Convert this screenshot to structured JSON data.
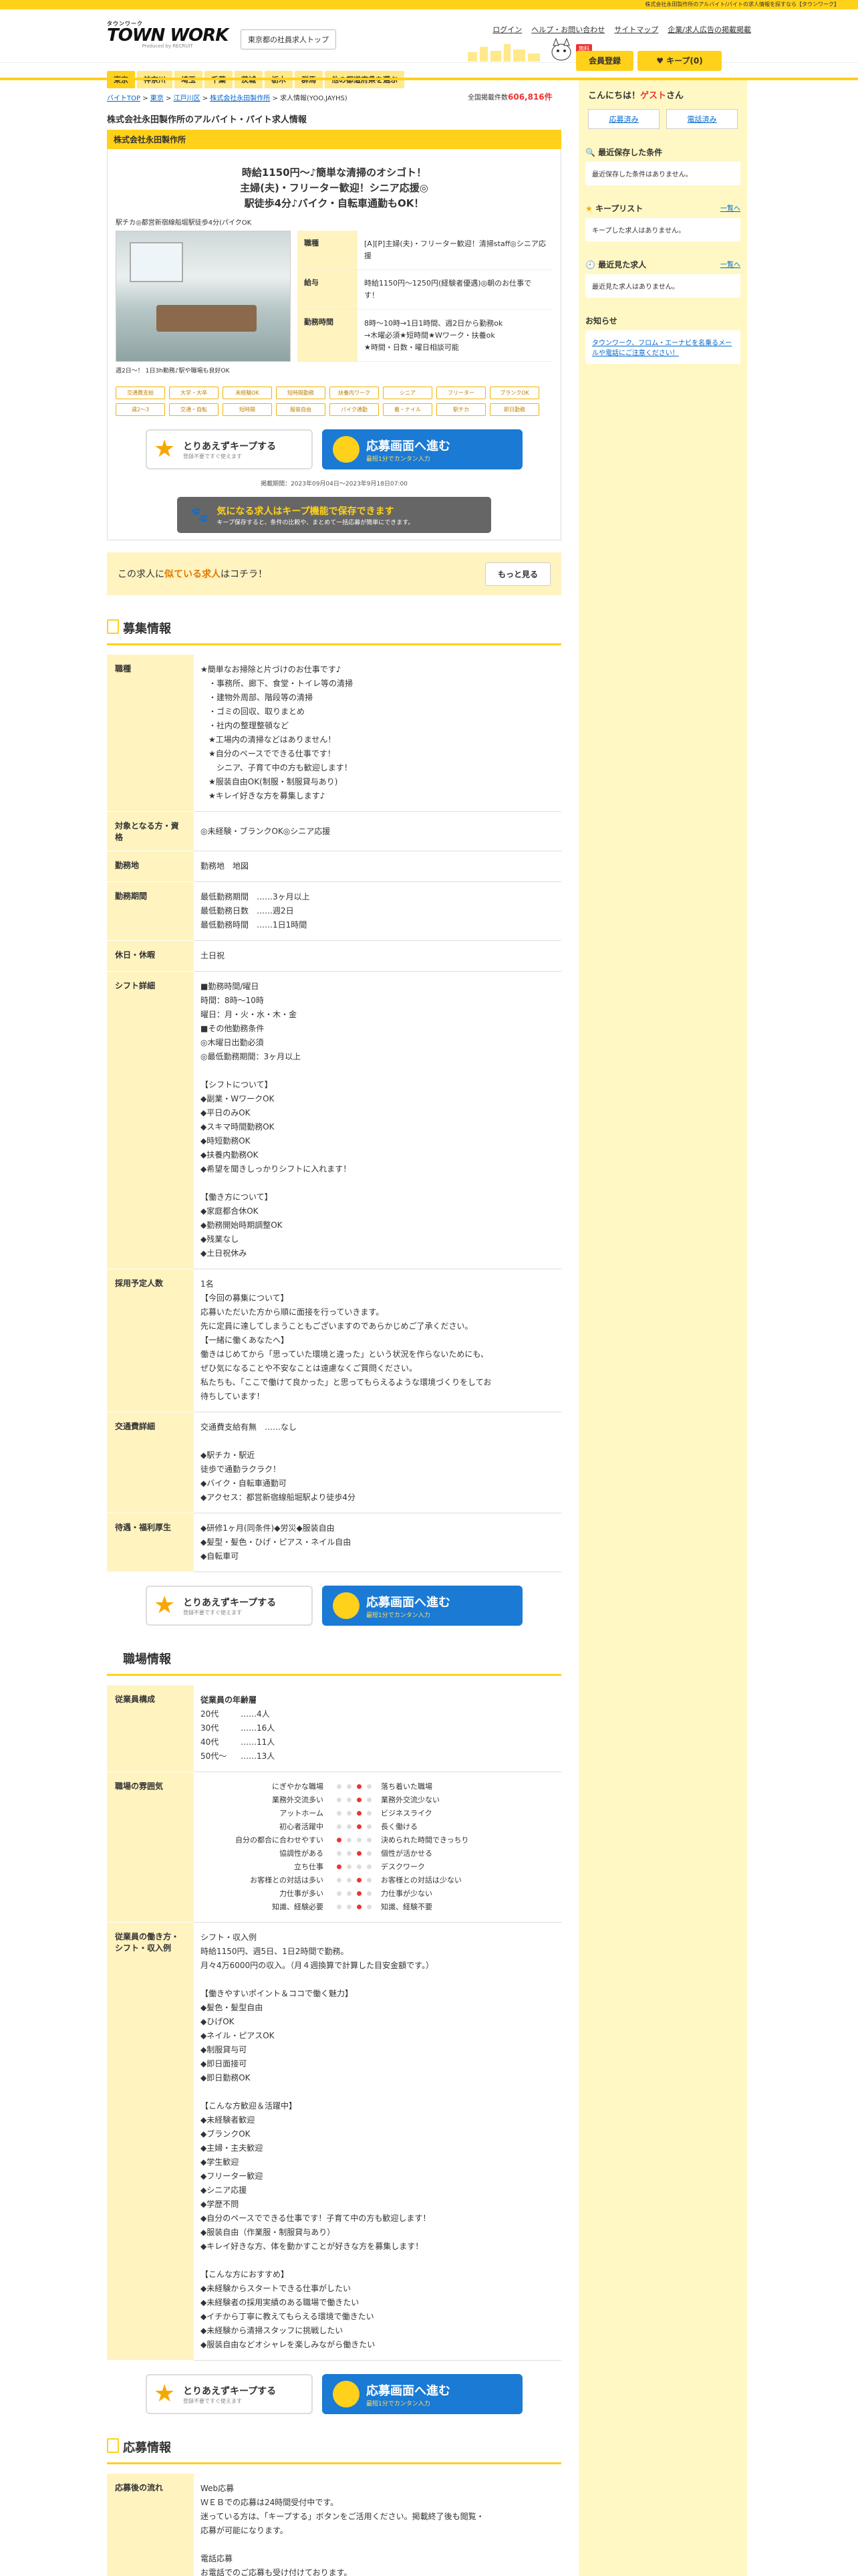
{
  "topbar": {
    "text": "株式会社永田製作所のアルバイト/パイトの求人情報を探すなら【タウンワーク】"
  },
  "header": {
    "logo_small": "タウンワーク",
    "logo_main": "TOWN WORK",
    "logo_sub": "Produced by RECRUIT",
    "store_button": "東京都の社員求人トップ",
    "utility": [
      "ログイン",
      "ヘルプ・お問い合わせ",
      "サイトマップ",
      "企業/求人広告の掲載掲載"
    ],
    "member_badge": "無料",
    "member_button": "会員登録",
    "keep_button": "キープ(0)"
  },
  "nav": [
    "東京",
    "神奈川",
    "埼玉",
    "千葉",
    "茨城",
    "栃木",
    "群馬",
    "他の都道府県を選ぶ"
  ],
  "breadcrumb": [
    "バイトTOP",
    "東京",
    "江戸川区",
    "株式会社永田製作所",
    "求人情報(YOO.JAYHS)"
  ],
  "total": {
    "label": "全国掲載件数",
    "value": "606,816件"
  },
  "page_title": "株式会社永田製作所のアルバイト・パイト求人情報",
  "job": {
    "company": "株式会社永田製作所",
    "catch_lines": [
      "時給1150円〜♪簡単な清掃のオシゴト！",
      "主婦(夫)・フリーター歓迎！シニア応援◎",
      "駅徒歩4分♪バイク・自転車通勤もOK！"
    ],
    "station": "駅チカ◎都営新宿線船堀駅徒歩4分(パイクOK",
    "photo_caption": "週2日〜！ 1日3h勤務♪駅や職場も良好OK",
    "summary": [
      {
        "label": "職種",
        "value": "[A][P]主婦(夫)・フリーター歓迎！清掃staff◎シニア応援"
      },
      {
        "label": "給与",
        "value": "時給1150円〜1250円(経験者優遇)◎朝のお仕事です！"
      },
      {
        "label": "勤務時間",
        "value": "8時〜10時→1日1時間、週2日から勤務ok\n→木曜必須★短時間★Wワーク・扶養ok\n★時間・日数・曜日相談可能"
      }
    ],
    "tags": [
      "交通費支給",
      "大学・大卒",
      "未経験OK",
      "短時間勤務",
      "扶養内ワーク",
      "シニア",
      "フリーター",
      "ブランクOK",
      "週2〜3",
      "交通・自転",
      "短時間",
      "服装自由",
      "バイク通勤",
      "着・ナイル",
      "駅チカ",
      "即日勤務"
    ],
    "keep_cta": {
      "title": "とりあえずキープする",
      "sub": "登録不要ですぐ使えます"
    },
    "apply_cta": {
      "title": "応募画面へ進む",
      "sub": "最短1分でカンタン入力"
    },
    "period": "掲載期間：2023年09月04日〜2023年9月18日07:00",
    "keep_banner": {
      "title": "気になる求人はキープ機能で保存できます",
      "sub": "キープ保存すると、条件の比較や、まとめて一括応募が簡単にできます。"
    },
    "similar": {
      "prefix": "この求人に",
      "highlight": "似ている求人",
      "suffix": "はコチラ！",
      "button": "もっと見る"
    }
  },
  "recruit": {
    "heading": "募集情報",
    "rows": [
      {
        "label": "職種",
        "value": "★簡単なお掃除と片づけのお仕事です♪\n　・事務所、廊下、食堂・トイレ等の清掃\n　・建物外周部、階段等の清掃\n　・ゴミの回収、取りまとめ\n　・社内の整理整頓など\n　★工場内の清掃などはありません！\n　★自分のペースでできる仕事です！\n　　シニア、子育て中の方も歓迎します！\n　★服装自由OK(制服・制服貸与あり)\n　★キレイ好きな方を募集します♪"
      },
      {
        "label": "対象となる方・資格",
        "value": "◎未経験・ブランクOK◎シニア応援"
      },
      {
        "label": "勤務地",
        "value": "勤務地　地図"
      },
      {
        "label": "勤務期間",
        "value": "最低勤務期間　……3ヶ月以上\n最低勤務日数　……週2日\n最低勤務時間　……1日1時間"
      },
      {
        "label": "休日・休暇",
        "value": "土日祝"
      },
      {
        "label": "シフト詳細",
        "value": "■勤務時間/曜日\n時間：8時〜10時\n曜日：月・火・水・木・金\n■その他勤務条件\n◎木曜日出勤必須\n◎最低勤務期間：3ヶ月以上\n\n【シフトについて】\n◆副業・WワークOK\n◆平日のみOK\n◆スキマ時間勤務OK\n◆時短勤務OK\n◆扶養内勤務OK\n◆希望を聞きしっかりシフトに入れます！\n\n【働き方について】\n◆家庭都合休OK\n◆勤務開始時期調整OK\n◆残業なし\n◆土日祝休み"
      },
      {
        "label": "採用予定人数",
        "value": "1名\n【今回の募集について】\n応募いただいた方から順に面接を行っていきます。\n先に定員に達してしまうこともございますのであらかじめご了承ください。\n【一緒に働くあなたへ】\n働きはじめてから「思っていた環境と違った」という状況を作らないためにも、\nぜひ気になることや不安なことは遠慮なくご質問ください。\n私たちも、「ここで働けて良かった」と思ってもらえるような環境づくりをしてお\n待ちしています！"
      },
      {
        "label": "交通費詳細",
        "value": "交通費支給有無　……なし\n\n◆駅チカ・駅近\n徒歩で通勤ラクラク！\n◆バイク・自転車通勤可\n◆アクセス：都営新宿線船堀駅より徒歩4分"
      },
      {
        "label": "待遇・福利厚生",
        "value": "◆研修1ヶ月(同条件)◆労災◆服装自由\n◆髪型・髪色・ひげ・ピアス・ネイル自由\n◆自転車可"
      }
    ]
  },
  "workplace": {
    "heading": "職場情報",
    "age_title": "従業員の年齢層",
    "ages": [
      {
        "label": "20代",
        "value": "……4人"
      },
      {
        "label": "30代",
        "value": "……16人"
      },
      {
        "label": "40代",
        "value": "……11人"
      },
      {
        "label": "50代〜",
        "value": "……13人"
      }
    ],
    "age_row_label": "従業員構成",
    "atmo_label": "職場の雰囲気",
    "atmosphere": [
      {
        "left": "にぎやかな職場",
        "right": "落ち着いた職場",
        "pos": 2
      },
      {
        "left": "業務外交流多い",
        "right": "業務外交流少ない",
        "pos": 2
      },
      {
        "left": "アットホーム",
        "right": "ビジネスライク",
        "pos": 2
      },
      {
        "left": "初心者活躍中",
        "right": "長く働ける",
        "pos": 2
      },
      {
        "left": "自分の都合に合わせやすい",
        "right": "決められた時間できっちり",
        "pos": 0
      },
      {
        "left": "協調性がある",
        "right": "個性が活かせる",
        "pos": 2
      },
      {
        "left": "立ち仕事",
        "right": "デスクワーク",
        "pos": 0
      },
      {
        "left": "お客様との対話は多い",
        "right": "お客様との対話は少ない",
        "pos": 2
      },
      {
        "left": "力仕事が多い",
        "right": "力仕事が少ない",
        "pos": 2
      },
      {
        "left": "知識、経験必要",
        "right": "知識、経験不要",
        "pos": 2
      }
    ],
    "example_label": "従業員の働き方・シフト・収入例",
    "example_value": "シフト・収入例\n時給1150円、週5日、1日2時間で勤務。\n月々4万6000円の収入。（月４週換算で計算した目安金額です。）\n\n【働きやすいポイント＆ココで働く魅力】\n◆髪色・髪型自由\n◆ひげOK\n◆ネイル・ピアスOK\n◆制服貸与可\n◆即日面接可\n◆即日勤務OK\n\n【こんな方歓迎＆活躍中】\n◆未経験者歓迎\n◆ブランクOK\n◆主婦・主夫歓迎\n◆学生歓迎\n◆フリーター歓迎\n◆シニア応援\n◆学歴不問\n◆自分のペースでできる仕事です！子育て中の方も歓迎します！\n◆服装自由（作業服・制服貸与あり）\n◆キレイ好きな方、体を動かすことが好きな方を募集します！\n\n【こんな方におすすめ】\n◆未経験からスタートできる仕事がしたい\n◆未経験者の採用実績のある職場で働きたい\n◆イチから丁寧に教えてもらえる環境で働きたい\n◆未経験から清掃スタッフに挑戦したい\n◆服装自由などオシャレを楽しみながら働きたい"
  },
  "apply": {
    "heading": "応募情報",
    "flow_label": "応募後の流れ",
    "flow_value": "Web応募\nＷＥＢでの応募は24時間受付中です。\n迷っている方は、「キープする」ボタンをご活用ください。掲載終了後も閲覧・\n応募が可能になります。\n\n電話応募\nお電話でのご応募も受け付けております。\n「タウンワークを見た」と言って頂けるとスムーズにお繋ぎすることができます。"
  },
  "sidebar": {
    "greet_prefix": "こんにちは！",
    "greet_name": "ゲスト",
    "greet_suffix": "さん",
    "btn_applied": "応募済み",
    "btn_phoned": "電話済み",
    "saved_title": "最近保存した条件",
    "saved_empty": "最近保存した条件はありません。",
    "keep_title": "キープリスト",
    "keep_link": "一覧へ",
    "keep_empty": "キープした求人はありません。",
    "recent_title": "最近見た求人",
    "recent_link": "一覧へ",
    "recent_empty": "最近見た求人はありません。",
    "notice_title": "お知らせ",
    "notice_text": "タウンワーク、フロム・エーナビを名乗るメールや電話にご注意ください！"
  }
}
